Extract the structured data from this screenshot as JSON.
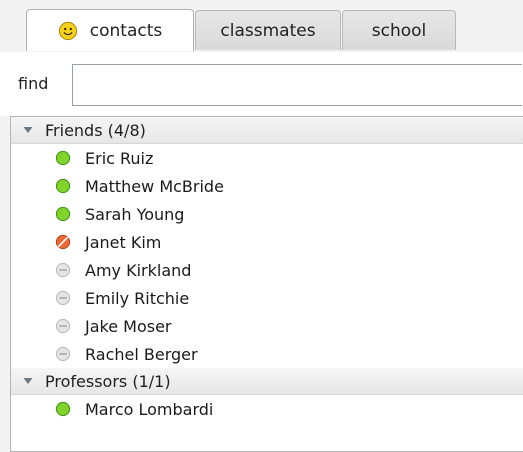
{
  "tabs": [
    {
      "label": "contacts",
      "icon": "smiley-icon",
      "active": true
    },
    {
      "label": "classmates",
      "active": false
    },
    {
      "label": "school",
      "active": false
    }
  ],
  "search": {
    "label": "find",
    "value": "",
    "placeholder": ""
  },
  "groups": [
    {
      "title": "Friends (4/8)",
      "contacts": [
        {
          "name": "Eric Ruiz",
          "status": "online"
        },
        {
          "name": "Matthew McBride",
          "status": "online"
        },
        {
          "name": "Sarah Young",
          "status": "online"
        },
        {
          "name": "Janet Kim",
          "status": "busy"
        },
        {
          "name": "Amy Kirkland",
          "status": "offline"
        },
        {
          "name": "Emily Ritchie",
          "status": "offline"
        },
        {
          "name": "Jake Moser",
          "status": "offline"
        },
        {
          "name": "Rachel Berger",
          "status": "offline"
        }
      ]
    },
    {
      "title": "Professors (1/1)",
      "contacts": [
        {
          "name": "Marco Lombardi",
          "status": "online"
        }
      ]
    }
  ],
  "colors": {
    "online": "#7fd32a",
    "busy": "#ef6a33",
    "offline": "#d6d6d6",
    "accent": "#f6c800"
  }
}
